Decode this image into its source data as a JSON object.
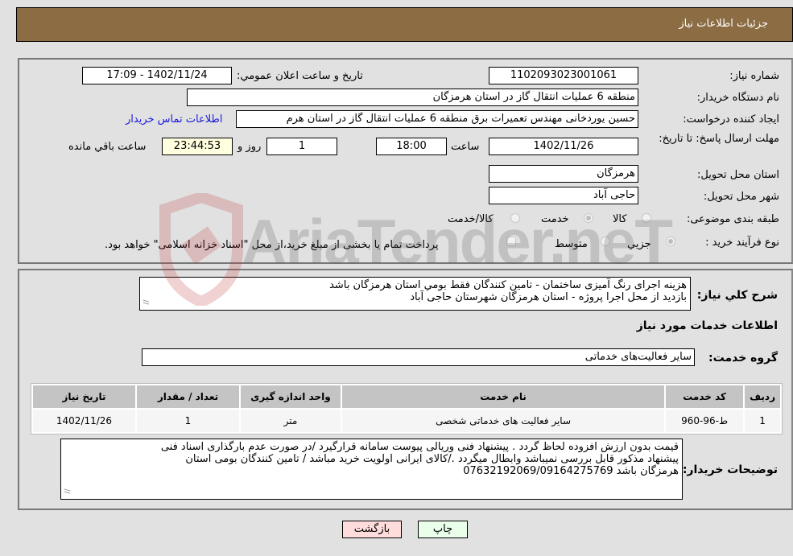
{
  "header": {
    "title": "جزئیات اطلاعات نیاز"
  },
  "fields": {
    "need_number_label": "شماره نیاز:",
    "need_number": "1102093023001061",
    "announce_label": "تاريخ و ساعت اعلان عمومي:",
    "announce_value": "1402/11/24 - 17:09",
    "buyer_org_label": "نام دستگاه خريدار:",
    "buyer_org": "منطقه 6 عمليات انتقال گاز در استان هرمزگان",
    "creator_label": "ايجاد کننده درخواست:",
    "creator": "حسين يوردخانی مهندس تعميرات برق منطقه 6 عمليات انتقال گاز در استان هرم",
    "contact_link": "اطلاعات تماس خريدار",
    "deadline_label": "مهلت ارسال پاسخ: تا تاريخ:",
    "deadline_date": "1402/11/26",
    "time_label": "ساعت",
    "deadline_time": "18:00",
    "days_value": "1",
    "days_label": "روز و",
    "remaining_time": "23:44:53",
    "remaining_label": "ساعت باقي مانده",
    "province_label": "استان محل تحويل:",
    "province": "هرمزگان",
    "city_label": "شهر محل تحويل:",
    "city": "حاجی آباد",
    "category_label": "طبقه بندی موضوعی:",
    "category_options": [
      {
        "label": "کالا",
        "checked": false
      },
      {
        "label": "خدمت",
        "checked": true
      },
      {
        "label": "کالا/خدمت",
        "checked": false
      }
    ],
    "process_label": "نوع فرآيند خريد :",
    "process_options": [
      {
        "label": "جزيي",
        "checked": true
      },
      {
        "label": "متوسط",
        "checked": false
      }
    ],
    "treasury_text": "پرداخت تمام يا بخشی از مبلغ خريد،از محل \"اسناد خزانه اسلامی\" خواهد بود."
  },
  "description": {
    "label": "شرح کلي نياز:",
    "lines": [
      "هزينه اجرای رنگ آميزی ساختمان - تامين کنندگان فقط بومي استان هرمزگان باشد",
      "بازديد از محل اجرا پروژه - استان هرمزگان شهرستان حاجی آباد"
    ]
  },
  "services": {
    "section_title": "اطلاعات خدمات مورد نياز",
    "group_label": "گروه خدمت:",
    "group_value": "ساير فعاليت‌های خدماتی",
    "table": {
      "headers": [
        "رديف",
        "کد خدمت",
        "نام خدمت",
        "واحد اندازه گيری",
        "تعداد / مقدار",
        "تاريخ نياز"
      ],
      "rows": [
        [
          "1",
          "ط-96-960",
          "ساير فعاليت های خدماتی شخصی",
          "متر",
          "1",
          "1402/11/26"
        ]
      ]
    }
  },
  "buyer_notes": {
    "label": "توضيحات خريدار:",
    "lines": [
      "قيمت بدون ارزش افزوده لحاظ گردد . پيشنهاد فنی وريالی پيوست سامانه قرارگيرد /در صورت عدم بارگذاری اسناد فنی",
      "پيشنهاد مذکور قابل بررسی نميباشد وابطال ميگردد ./کالای ايرانی اولويت خريد مباشد / تامين کنندگان بومی استان",
      "هرمزگان باشد 07632192069/09164275769"
    ]
  },
  "buttons": {
    "print": "چاپ",
    "back": "بازگشت"
  },
  "watermark": {
    "text": "AriaTender.neT"
  }
}
